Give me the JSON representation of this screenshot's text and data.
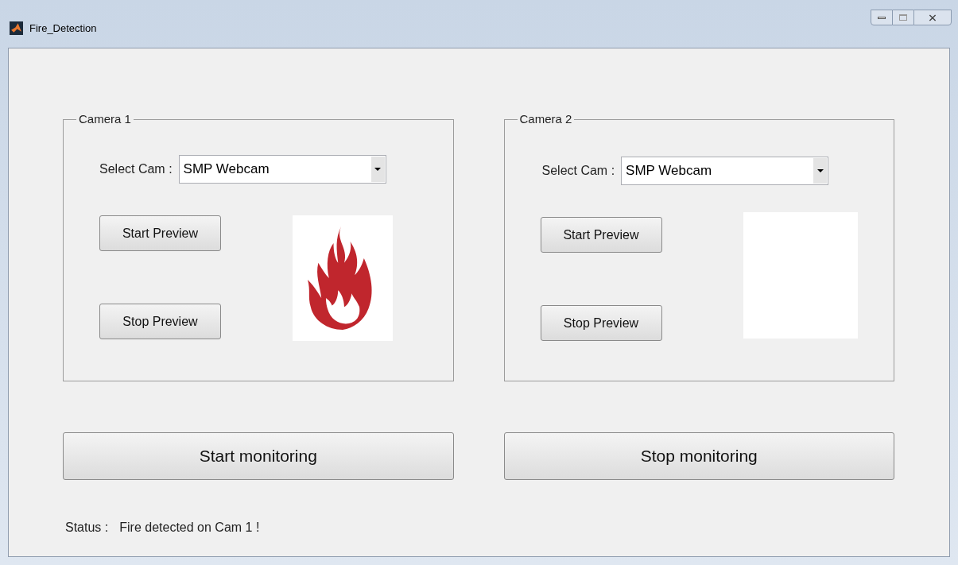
{
  "window": {
    "title": "Fire_Detection"
  },
  "cameras": [
    {
      "title": "Camera 1",
      "select_label": "Select Cam :",
      "device": "SMP Webcam",
      "start_button": "Start Preview",
      "stop_button": "Stop Preview",
      "preview": {
        "kind": "fire"
      }
    },
    {
      "title": "Camera 2",
      "select_label": "Select Cam :",
      "device": "SMP Webcam",
      "start_button": "Start Preview",
      "stop_button": "Stop Preview",
      "preview": {
        "kind": "blank"
      }
    }
  ],
  "buttons": [
    "Start monitoring",
    "Stop monitoring"
  ],
  "status": {
    "label": "Status :",
    "message": "Fire detected on Cam 1 !"
  }
}
